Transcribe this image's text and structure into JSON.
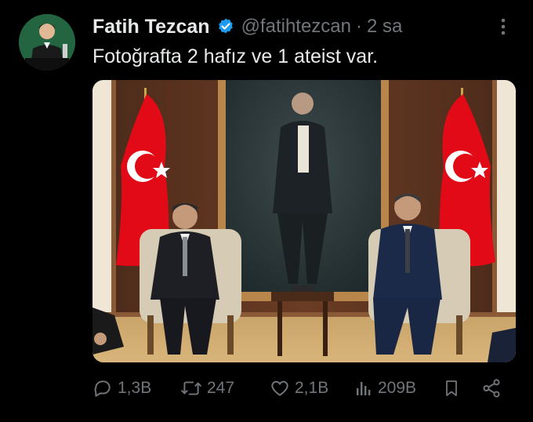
{
  "tweet": {
    "author_name": "Fatih Tezcan",
    "handle": "@fatihtezcan",
    "separator": "·",
    "time": "2 sa",
    "text": "Fotoğrafta 2 hafız ve 1 ateist var."
  },
  "actions": {
    "replies": "1,3B",
    "reposts": "247",
    "likes": "2,1B",
    "views": "209B"
  },
  "colors": {
    "background": "#000000",
    "text": "#e7e9ea",
    "muted": "#71767b",
    "verified": "#1d9bf0",
    "flag_red": "#e30a17"
  },
  "icons": [
    "verified-badge-icon",
    "more-options-icon",
    "reply-icon",
    "repost-icon",
    "like-icon",
    "views-icon",
    "bookmark-icon",
    "share-icon"
  ]
}
